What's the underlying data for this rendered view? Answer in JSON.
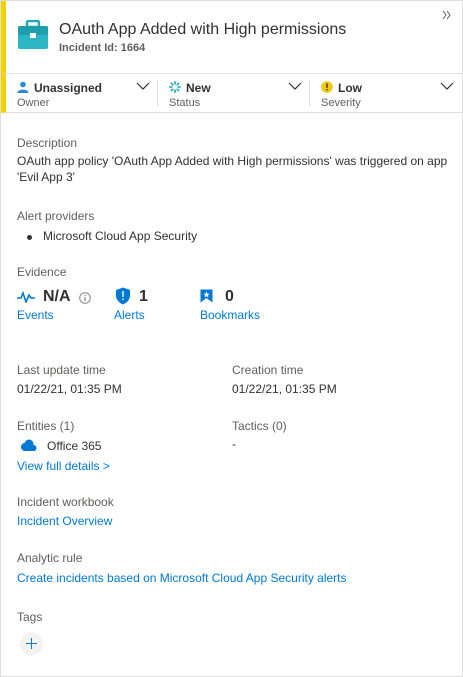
{
  "header": {
    "title": "OAuth App Added with High permissions",
    "incident_id": "Incident Id: 1664",
    "expand_icon": "double-chevron-right-icon",
    "case_icon": "briefcase-icon",
    "accent": "#f2d300"
  },
  "status_bar": {
    "owner": {
      "value": "Unassigned",
      "label": "Owner",
      "icon": "person-icon"
    },
    "status": {
      "value": "New",
      "label": "Status",
      "icon": "spinner-icon"
    },
    "severity": {
      "value": "Low",
      "label": "Severity",
      "icon": "warning-circle-icon"
    }
  },
  "description": {
    "label": "Description",
    "text": "OAuth app policy 'OAuth App Added with High permissions' was triggered on app 'Evil App 3'"
  },
  "alert_providers": {
    "label": "Alert providers",
    "items": [
      "Microsoft Cloud App Security"
    ]
  },
  "evidence": {
    "label": "Evidence",
    "events": {
      "value": "N/A",
      "label": "Events",
      "icon": "pulse-icon"
    },
    "alerts": {
      "value": "1",
      "label": "Alerts",
      "icon": "shield-icon"
    },
    "bookmarks": {
      "value": "0",
      "label": "Bookmarks",
      "icon": "bookmark-icon"
    }
  },
  "times": {
    "last_update_label": "Last update time",
    "last_update_value": "01/22/21, 01:35 PM",
    "creation_label": "Creation time",
    "creation_value": "01/22/21, 01:35 PM"
  },
  "entities": {
    "label": "Entities (1)",
    "item": "Office 365",
    "item_icon": "cloud-icon",
    "details_link": "View full details >"
  },
  "tactics": {
    "label": "Tactics (0)",
    "value": "-"
  },
  "workbook": {
    "label": "Incident workbook",
    "link": "Incident Overview"
  },
  "analytic_rule": {
    "label": "Analytic rule",
    "link": "Create incidents based on Microsoft Cloud App Security alerts"
  },
  "tags": {
    "label": "Tags",
    "add_icon": "plus-icon"
  },
  "colors": {
    "link": "#0078d4",
    "muted": "#605e5c",
    "text": "#323130",
    "warning": "#f2c811"
  }
}
